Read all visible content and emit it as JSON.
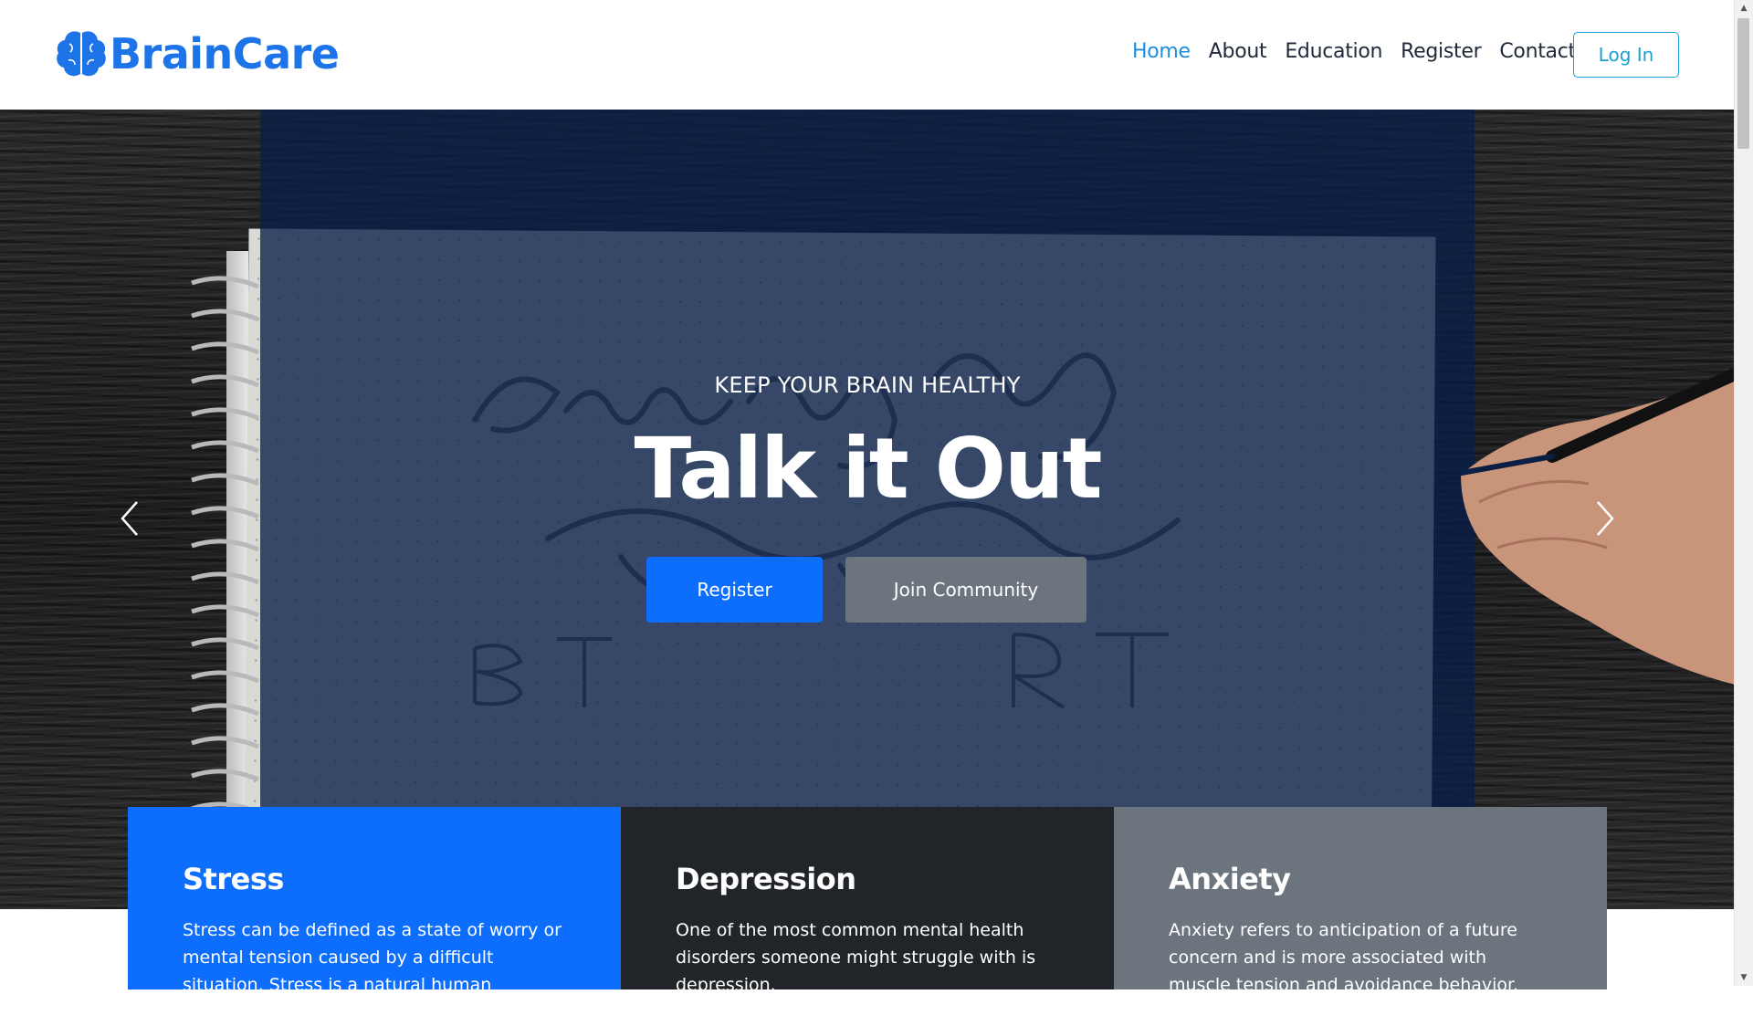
{
  "navbar": {
    "brand": "BrainCare",
    "links": [
      "Home",
      "About",
      "Education",
      "Register",
      "Contact"
    ],
    "active": "Home",
    "login_label": "Log In"
  },
  "hero": {
    "subtitle": "KEEP YOUR BRAIN HEALTHY",
    "title": "Talk it Out",
    "register_label": "Register",
    "community_label": "Join Community"
  },
  "cards": [
    {
      "title": "Stress",
      "text": "Stress can be defined as a state of worry or mental tension caused by a difficult situation. Stress is a natural human response that"
    },
    {
      "title": "Depression",
      "text": "One of the most common mental health disorders someone might struggle with is depression."
    },
    {
      "title": "Anxiety",
      "text": "Anxiety refers to anticipation of a future concern and is more associated with muscle tension and avoidance behavior. Fear is an"
    }
  ],
  "colors": {
    "brand": "#1c74e8",
    "nav_active": "#1c8fe0",
    "primary": "#0d6efd",
    "secondary": "#6c757d",
    "dark": "#212529",
    "overlay": "#081e48"
  },
  "icons": {
    "brand": "brain-icon",
    "prev": "chevron-left-icon",
    "next": "chevron-right-icon"
  }
}
